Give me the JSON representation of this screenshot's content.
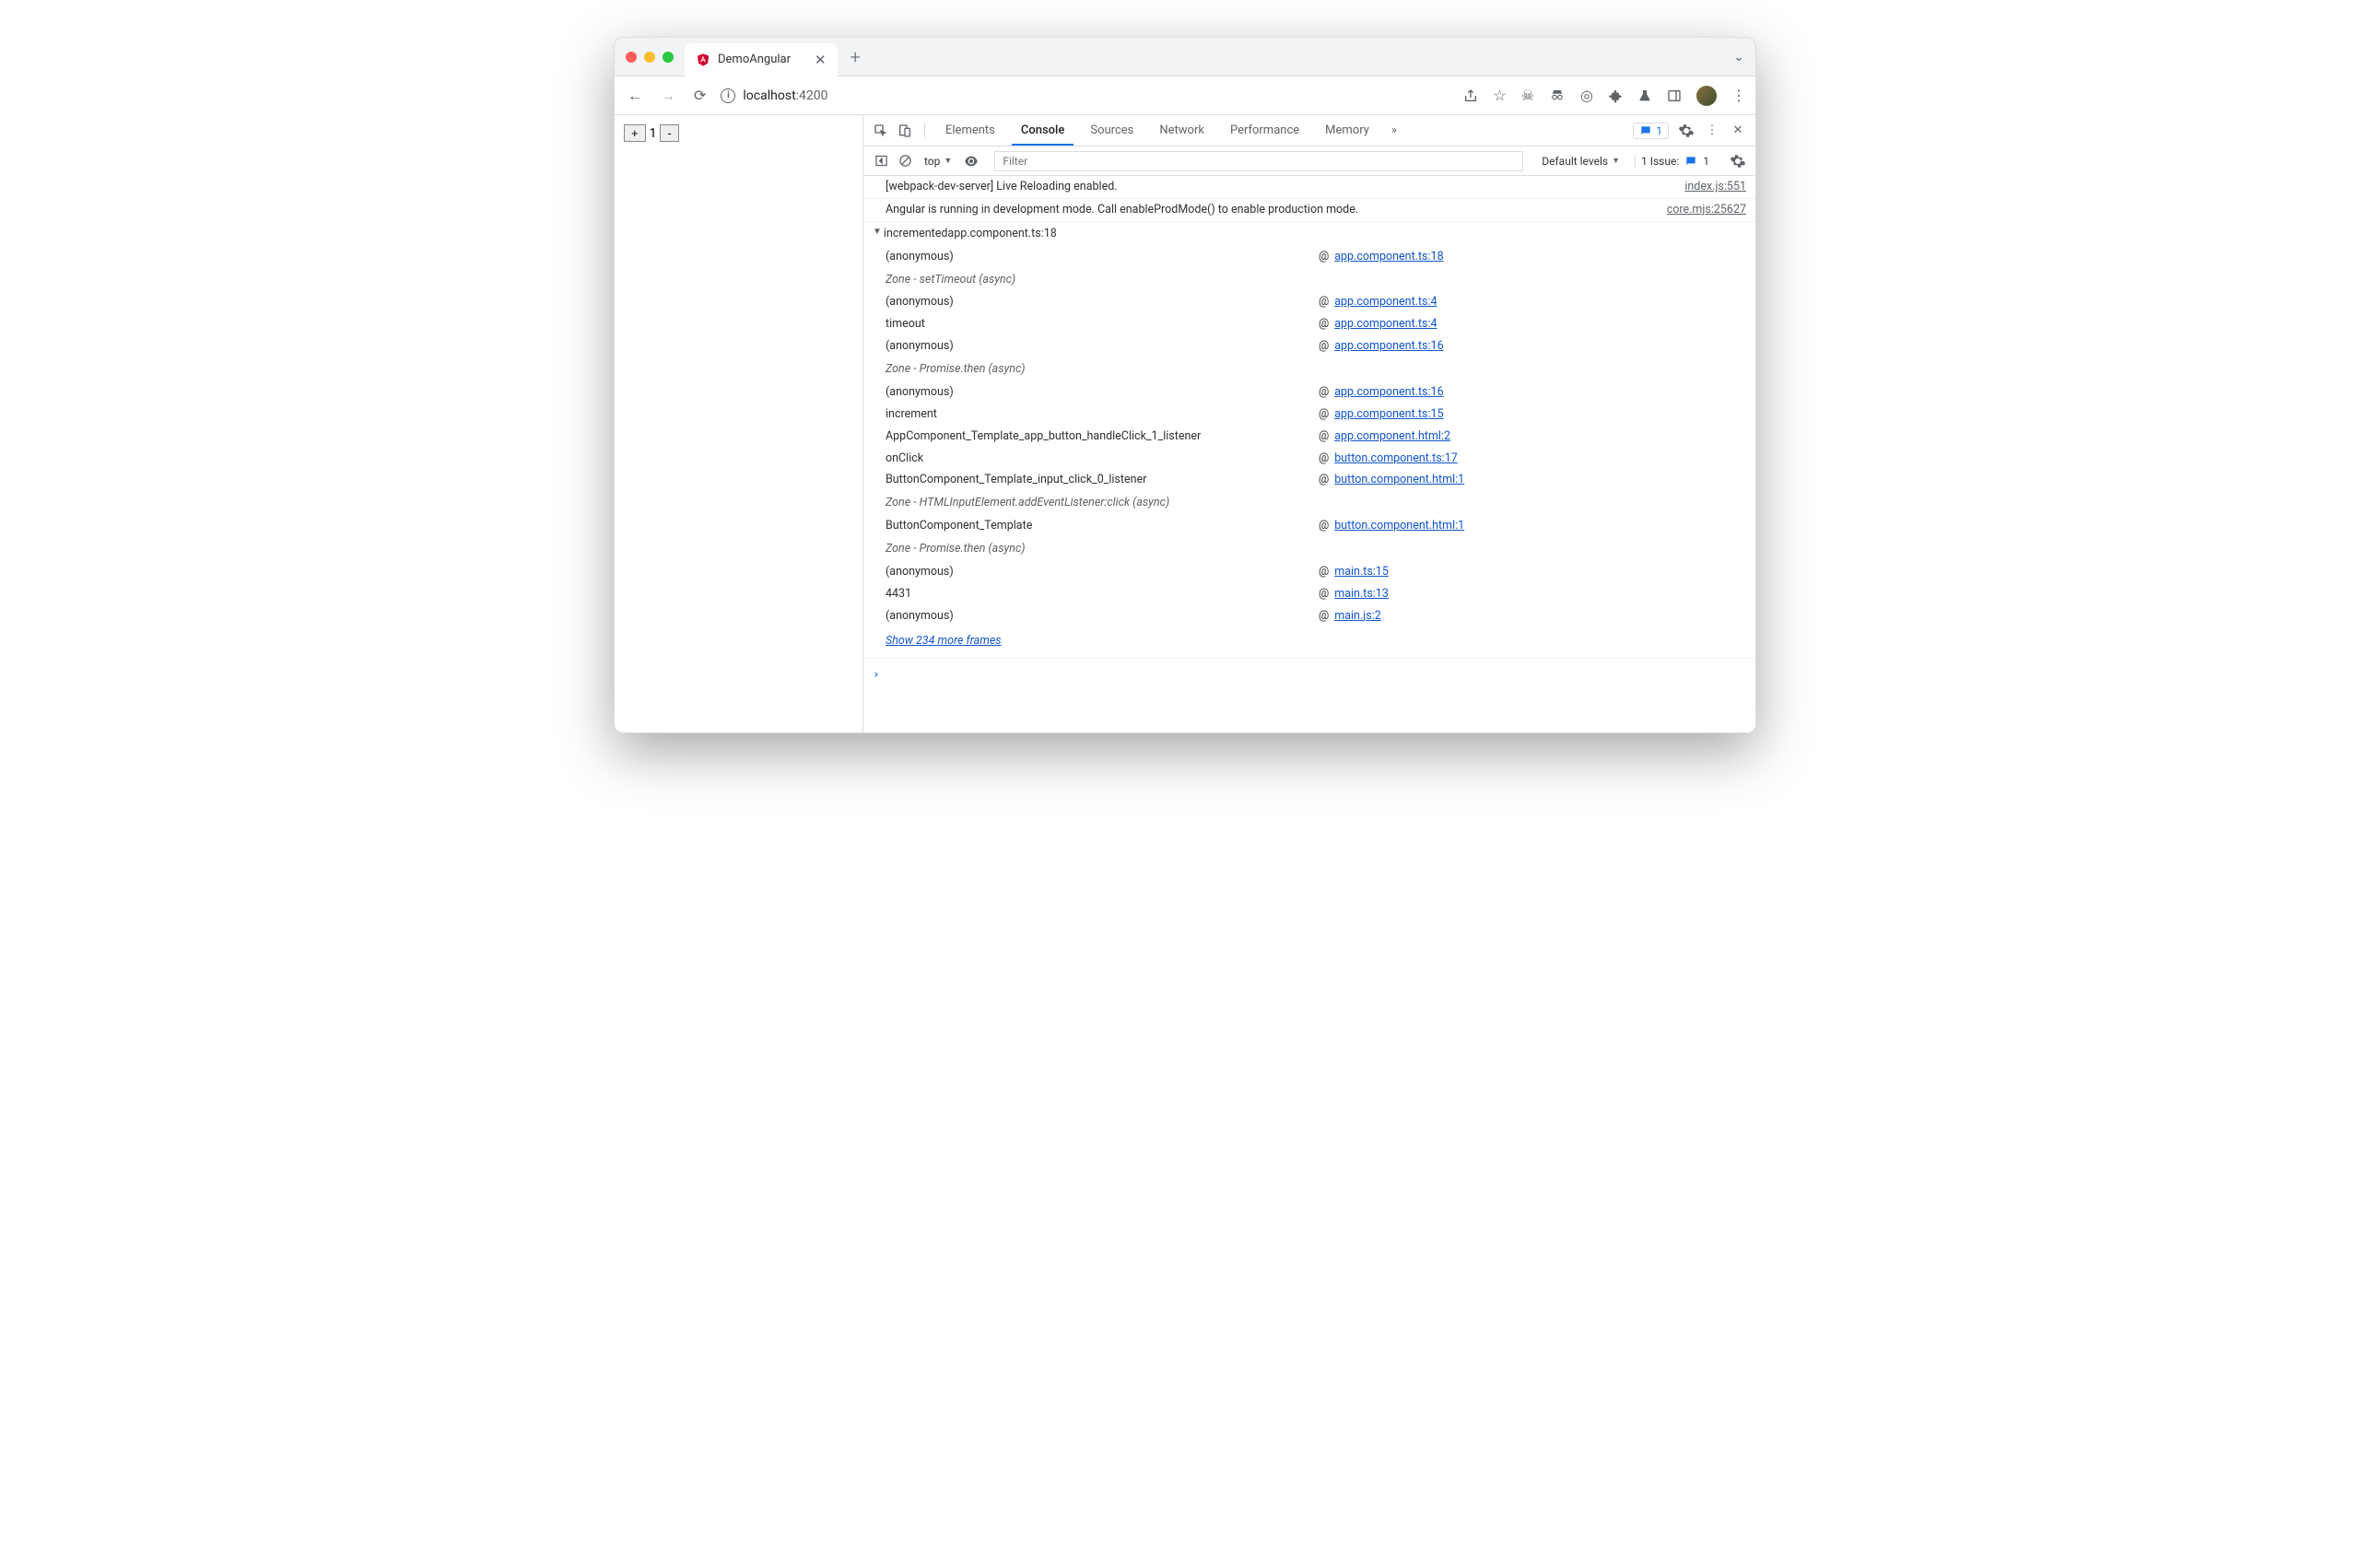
{
  "browser": {
    "tab_title": "DemoAngular",
    "url_host": "localhost",
    "url_port": ":4200"
  },
  "page": {
    "plus": "+",
    "count": "1",
    "minus": "-"
  },
  "devtools": {
    "tabs": [
      "Elements",
      "Console",
      "Sources",
      "Network",
      "Performance",
      "Memory"
    ],
    "active_tab": "Console",
    "messages_badge": "1",
    "context": "top",
    "filter_placeholder": "Filter",
    "levels": "Default levels",
    "issues_label": "1 Issue:",
    "issues_count": "1"
  },
  "logs": [
    {
      "msg": "[webpack-dev-server] Live Reloading enabled.",
      "src": "index.js:551"
    },
    {
      "msg": "Angular is running in development mode. Call enableProdMode() to enable production mode.",
      "src": "core.mjs:25627"
    }
  ],
  "trace": {
    "header": "incremented",
    "header_src": "app.component.ts:18",
    "frames": [
      {
        "fn": "(anonymous)",
        "link": "app.component.ts:18"
      },
      {
        "zone": "Zone - setTimeout (async)"
      },
      {
        "fn": "(anonymous)",
        "link": "app.component.ts:4"
      },
      {
        "fn": "timeout",
        "link": "app.component.ts:4"
      },
      {
        "fn": "(anonymous)",
        "link": "app.component.ts:16"
      },
      {
        "zone": "Zone - Promise.then (async)"
      },
      {
        "fn": "(anonymous)",
        "link": "app.component.ts:16"
      },
      {
        "fn": "increment",
        "link": "app.component.ts:15"
      },
      {
        "fn": "AppComponent_Template_app_button_handleClick_1_listener",
        "link": "app.component.html:2"
      },
      {
        "fn": "onClick",
        "link": "button.component.ts:17"
      },
      {
        "fn": "ButtonComponent_Template_input_click_0_listener",
        "link": "button.component.html:1"
      },
      {
        "zone": "Zone - HTMLInputElement.addEventListener:click (async)"
      },
      {
        "fn": "ButtonComponent_Template",
        "link": "button.component.html:1"
      },
      {
        "zone": "Zone - Promise.then (async)"
      },
      {
        "fn": "(anonymous)",
        "link": "main.ts:15"
      },
      {
        "fn": "4431",
        "link": "main.ts:13"
      },
      {
        "fn": "(anonymous)",
        "link": "main.js:2"
      }
    ],
    "show_more": "Show 234 more frames"
  }
}
